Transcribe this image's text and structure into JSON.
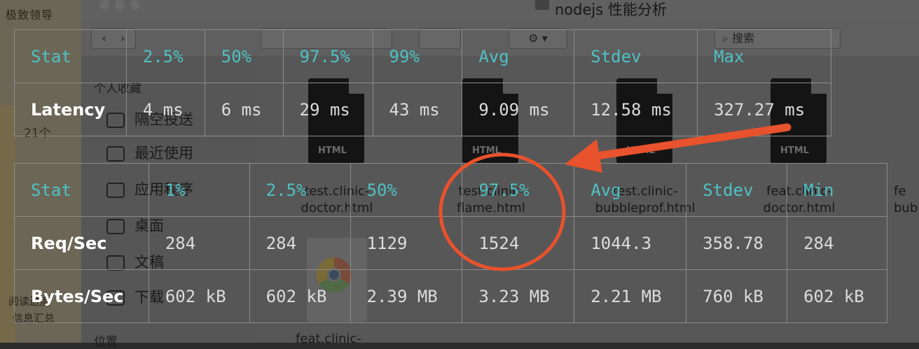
{
  "colors": {
    "header_text": "#4fc1c4",
    "body_text": "#dcdcdc",
    "row_label": "#ffffff",
    "grid": "#8c8c8c",
    "annotation": "#e8522c"
  },
  "background": {
    "left_title": "极致领导",
    "left_count": "21个",
    "left_bottom": [
      "阅读进度",
      "信息汇总"
    ],
    "window_title": "nodejs 性能分析",
    "toolbar": {
      "back": "‹",
      "forward": "›",
      "gear": "⚙",
      "search_placeholder": "搜索"
    },
    "sidebar": {
      "favorites_header": "个人收藏",
      "items": [
        {
          "label": "隔空投送",
          "icon": "airdrop-icon"
        },
        {
          "label": "最近使用",
          "icon": "clock-icon"
        },
        {
          "label": "应用程序",
          "icon": "apps-icon"
        },
        {
          "label": "桌面",
          "icon": "desktop-icon"
        },
        {
          "label": "文稿",
          "icon": "document-icon"
        },
        {
          "label": "下载",
          "icon": "download-icon"
        }
      ],
      "locations_header": "位置"
    },
    "files": [
      {
        "name_line1": "test.clinic-",
        "name_line2": "doctor.html",
        "badge": "HTML"
      },
      {
        "name_line1": "test.clinic-",
        "name_line2": "flame.html",
        "badge": "HTML"
      },
      {
        "name_line1": "test.clinic-",
        "name_line2": "bubbleprof.html",
        "badge": "HTML"
      },
      {
        "name_line1": "feat.clinic-",
        "name_line2": "doctor.html",
        "badge": "HTML"
      }
    ],
    "partial_file": [
      "fe",
      "bubble"
    ],
    "bottom_file": "feat.clinic-"
  },
  "latency_table": {
    "headers": [
      "Stat",
      "2.5%",
      "50%",
      "97.5%",
      "99%",
      "Avg",
      "Stdev",
      "Max"
    ],
    "rows": [
      {
        "label": "Latency",
        "values": [
          "4 ms",
          "6 ms",
          "29 ms",
          "43 ms",
          "9.09 ms",
          "12.58 ms",
          "327.27 ms"
        ]
      }
    ]
  },
  "throughput_table": {
    "headers": [
      "Stat",
      "1%",
      "2.5%",
      "50%",
      "97.5%",
      "Avg",
      "Stdev",
      "Min"
    ],
    "rows": [
      {
        "label": "Req/Sec",
        "values": [
          "284",
          "284",
          "1129",
          "1524",
          "1044.3",
          "358.78",
          "284"
        ]
      },
      {
        "label": "Bytes/Sec",
        "values": [
          "602 kB",
          "602 kB",
          "2.39 MB",
          "3.23 MB",
          "2.21 MB",
          "760 kB",
          "602 kB"
        ]
      }
    ]
  }
}
